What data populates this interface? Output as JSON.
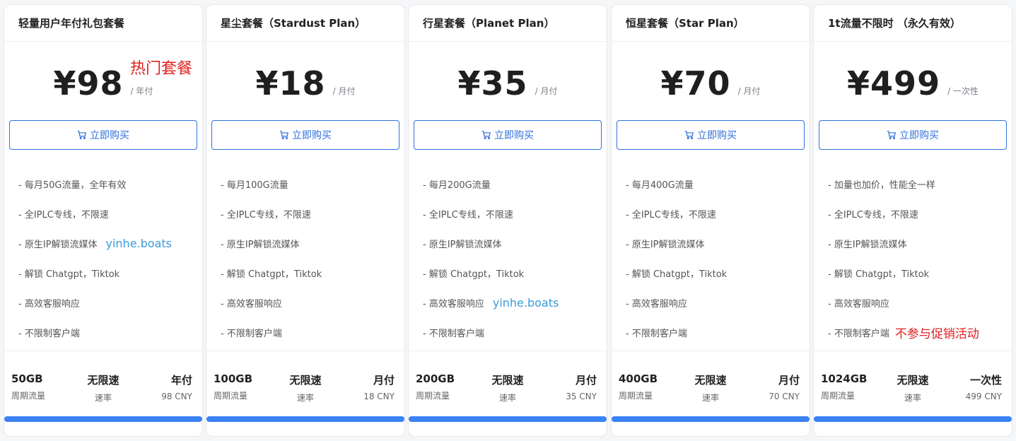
{
  "buy_label": "立即购买",
  "colors": {
    "accent": "#3b82f6",
    "button": "#2f6fdc",
    "hot": "#e02020",
    "link": "#3a9ad9"
  },
  "plans": [
    {
      "title": "轻量用户年付礼包套餐",
      "price": "¥98",
      "unit": "/ 年付",
      "hot": "热门套餐",
      "features": [
        "- 每月50G流量，全年有效",
        "- 全IPLC专线，不限速",
        "- 原生IP解锁流媒体",
        "- 解锁 Chatgpt，Tiktok",
        "- 高效客服响应",
        "- 不限制客户端"
      ],
      "feature_note": {
        "index": 2,
        "text": "yinhe.boats"
      },
      "stats": [
        {
          "value": "50GB",
          "label": "周期流量"
        },
        {
          "value": "无限速",
          "label": "速率"
        },
        {
          "value": "年付",
          "label": "98 CNY"
        }
      ]
    },
    {
      "title": "星尘套餐（Stardust Plan）",
      "price": "¥18",
      "unit": "/ 月付",
      "features": [
        "- 每月100G流量",
        "- 全IPLC专线，不限速",
        "- 原生IP解锁流媒体",
        "- 解锁 Chatgpt，Tiktok",
        "- 高效客服响应",
        "- 不限制客户端"
      ],
      "stats": [
        {
          "value": "100GB",
          "label": "周期流量"
        },
        {
          "value": "无限速",
          "label": "速率"
        },
        {
          "value": "月付",
          "label": "18 CNY"
        }
      ]
    },
    {
      "title": "行星套餐（Planet Plan）",
      "price": "¥35",
      "unit": "/ 月付",
      "features": [
        "- 每月200G流量",
        "- 全IPLC专线，不限速",
        "- 原生IP解锁流媒体",
        "- 解锁 Chatgpt，Tiktok",
        "- 高效客服响应",
        "- 不限制客户端"
      ],
      "feature_note": {
        "index": 4,
        "text": "yinhe.boats"
      },
      "stats": [
        {
          "value": "200GB",
          "label": "周期流量"
        },
        {
          "value": "无限速",
          "label": "速率"
        },
        {
          "value": "月付",
          "label": "35 CNY"
        }
      ]
    },
    {
      "title": "恒星套餐（Star Plan）",
      "price": "¥70",
      "unit": "/ 月付",
      "features": [
        "- 每月400G流量",
        "- 全IPLC专线，不限速",
        "- 原生IP解锁流媒体",
        "- 解锁 Chatgpt，Tiktok",
        "- 高效客服响应",
        "- 不限制客户端"
      ],
      "stats": [
        {
          "value": "400GB",
          "label": "周期流量"
        },
        {
          "value": "无限速",
          "label": "速率"
        },
        {
          "value": "月付",
          "label": "70 CNY"
        }
      ]
    },
    {
      "title": "1t流量不限时 （永久有效）",
      "price": "¥499",
      "unit": "/ 一次性",
      "features": [
        "- 加量也加价，性能全一样",
        "- 全IPLC专线，不限速",
        "- 原生IP解锁流媒体",
        "- 解锁 Chatgpt，Tiktok",
        "- 高效客服响应",
        "- 不限制客户端"
      ],
      "red_note": {
        "index": 5,
        "text": "不参与促销活动"
      },
      "stats": [
        {
          "value": "1024GB",
          "label": "周期流量"
        },
        {
          "value": "无限速",
          "label": "速率"
        },
        {
          "value": "一次性",
          "label": "499 CNY"
        }
      ]
    }
  ]
}
